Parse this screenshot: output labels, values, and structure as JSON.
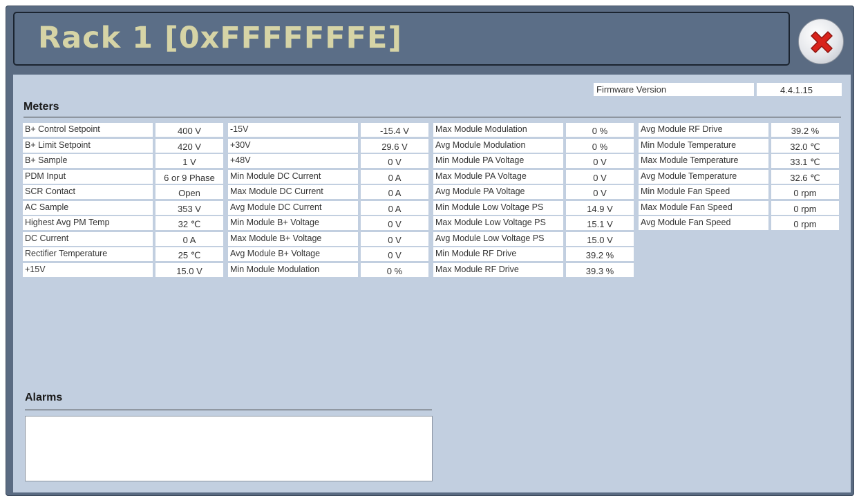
{
  "window": {
    "title": "Rack 1 [0xFFFFFFFE]",
    "close_icon": "close-icon"
  },
  "firmware": {
    "label": "Firmware Version",
    "value": "4.4.1.15"
  },
  "sections": {
    "meters": "Meters",
    "alarms": "Alarms"
  },
  "meters": {
    "col1": [
      {
        "label": "B+ Control Setpoint",
        "value": "400 V"
      },
      {
        "label": "B+ Limit Setpoint",
        "value": "420 V"
      },
      {
        "label": "B+ Sample",
        "value": "1 V"
      },
      {
        "label": "PDM Input",
        "value": "6 or 9 Phase"
      },
      {
        "label": "SCR Contact",
        "value": "Open"
      },
      {
        "label": "AC Sample",
        "value": "353 V"
      },
      {
        "label": "Highest Avg PM Temp",
        "value": "32 ℃"
      },
      {
        "label": "DC Current",
        "value": "0 A"
      },
      {
        "label": "Rectifier Temperature",
        "value": "25 ℃"
      },
      {
        "label": "+15V",
        "value": "15.0 V"
      }
    ],
    "col2": [
      {
        "label": "-15V",
        "value": "-15.4 V"
      },
      {
        "label": "+30V",
        "value": "29.6 V"
      },
      {
        "label": "+48V",
        "value": "0 V"
      },
      {
        "label": "Min Module DC Current",
        "value": "0 A"
      },
      {
        "label": "Max Module DC Current",
        "value": "0 A"
      },
      {
        "label": "Avg Module DC Current",
        "value": "0 A"
      },
      {
        "label": "Min Module B+ Voltage",
        "value": "0 V"
      },
      {
        "label": "Max Module B+ Voltage",
        "value": "0 V"
      },
      {
        "label": "Avg Module B+ Voltage",
        "value": "0 V"
      },
      {
        "label": "Min Module Modulation",
        "value": "0 %"
      }
    ],
    "col3": [
      {
        "label": "Max Module Modulation",
        "value": "0 %"
      },
      {
        "label": "Avg Module Modulation",
        "value": "0 %"
      },
      {
        "label": "Min Module PA Voltage",
        "value": "0 V"
      },
      {
        "label": "Max Module PA Voltage",
        "value": "0 V"
      },
      {
        "label": "Avg Module PA Voltage",
        "value": "0 V"
      },
      {
        "label": "Min Module Low Voltage PS",
        "value": "14.9 V"
      },
      {
        "label": "Max Module Low Voltage PS",
        "value": "15.1 V"
      },
      {
        "label": "Avg Module Low Voltage PS",
        "value": "15.0 V"
      },
      {
        "label": "Min Module RF Drive",
        "value": "39.2 %"
      },
      {
        "label": "Max Module RF Drive",
        "value": "39.3 %"
      }
    ],
    "col4": [
      {
        "label": "Avg Module RF Drive",
        "value": "39.2 %"
      },
      {
        "label": "Min Module Temperature",
        "value": "32.0 ℃"
      },
      {
        "label": "Max Module Temperature",
        "value": "33.1 ℃"
      },
      {
        "label": "Avg Module Temperature",
        "value": "32.6 ℃"
      },
      {
        "label": "Min Module Fan Speed",
        "value": "0 rpm"
      },
      {
        "label": "Max Module Fan Speed",
        "value": "0 rpm"
      },
      {
        "label": "Avg Module Fan Speed",
        "value": "0 rpm"
      }
    ]
  }
}
